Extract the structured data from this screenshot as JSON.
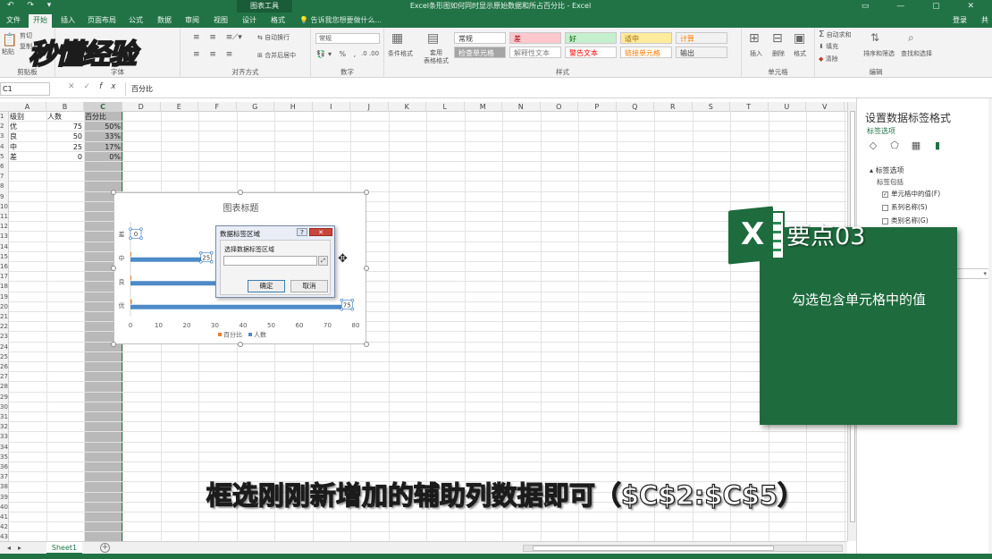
{
  "titlebar": {
    "quick_access": "↶ ↷ ▾",
    "context_tab": "图表工具",
    "document": "Excel条形图如何同时显示原始数据和所占百分比 - Excel",
    "window_controls": "▭ — ▢ ✕"
  },
  "tabs": [
    "文件",
    "开始",
    "插入",
    "页面布局",
    "公式",
    "数据",
    "审阅",
    "视图",
    "设计",
    "格式"
  ],
  "active_tab_index": 1,
  "tell_me": "告诉我您想要做什么...",
  "login": "登录",
  "share": "共享",
  "ribbon": {
    "clipboard": {
      "label": "剪贴板",
      "cut": "剪切",
      "copy": "复制",
      "paste": "粘贴"
    },
    "font": {
      "label": "字体"
    },
    "alignment": {
      "label": "对齐方式",
      "wrap": "自动换行",
      "merge": "合并后居中"
    },
    "number": {
      "label": "数字",
      "format": "常规"
    },
    "styles": {
      "label": "样式",
      "conditional": "条件格式",
      "table": "套用\n表格格式",
      "cells": [
        {
          "text": "常规",
          "bg": "#ffffff",
          "fg": "#333333"
        },
        {
          "text": "差",
          "bg": "#ffc7ce",
          "fg": "#9c0006"
        },
        {
          "text": "好",
          "bg": "#c6efce",
          "fg": "#006100"
        },
        {
          "text": "适中",
          "bg": "#ffeb9c",
          "fg": "#9c6500"
        },
        {
          "text": "计算",
          "bg": "#f2f2f2",
          "fg": "#fa7d00"
        },
        {
          "text": "检查单元格",
          "bg": "#a5a5a5",
          "fg": "#ffffff"
        },
        {
          "text": "解释性文本",
          "bg": "#ffffff",
          "fg": "#7f7f7f"
        },
        {
          "text": "警告文本",
          "bg": "#ffffff",
          "fg": "#ff0000"
        },
        {
          "text": "链接单元格",
          "bg": "#ffffff",
          "fg": "#fa7d00"
        },
        {
          "text": "输出",
          "bg": "#f2f2f2",
          "fg": "#3f3f3f"
        }
      ]
    },
    "cells": {
      "label": "单元格",
      "insert": "插入",
      "delete": "删除",
      "format": "格式"
    },
    "editing": {
      "label": "编辑",
      "autosum": "自动求和",
      "fill": "填充",
      "clear": "清除",
      "sort": "排序和筛选",
      "find": "查找和选择"
    }
  },
  "watermark": "秒懂经验",
  "formula_bar": {
    "name_box": "C1",
    "cancel": "✕",
    "enter": "✓",
    "fx": "fx",
    "formula": "百分比"
  },
  "columns": [
    "A",
    "B",
    "C",
    "D",
    "E",
    "F",
    "G",
    "H",
    "I",
    "J",
    "K",
    "L",
    "M",
    "N",
    "O",
    "P",
    "Q",
    "R",
    "S",
    "T",
    "U",
    "V"
  ],
  "rows": [
    "1",
    "2",
    "3",
    "4",
    "5",
    "6",
    "7",
    "8",
    "9",
    "10",
    "11",
    "12",
    "13",
    "14",
    "15",
    "16",
    "17",
    "18",
    "19",
    "20",
    "21",
    "22",
    "23",
    "24",
    "25",
    "26",
    "27",
    "28",
    "29",
    "30",
    "31",
    "32",
    "33",
    "34",
    "35",
    "36",
    "37",
    "38",
    "39",
    "40",
    "41",
    "42",
    "43"
  ],
  "table": {
    "headers": [
      "级别",
      "人数",
      "百分比"
    ],
    "rows": [
      [
        "优",
        "75",
        "50%"
      ],
      [
        "良",
        "50",
        "33%"
      ],
      [
        "中",
        "25",
        "17%"
      ],
      [
        "差",
        "0",
        "0%"
      ]
    ]
  },
  "chart_data": {
    "type": "bar",
    "title": "图表标题",
    "categories": [
      "差",
      "中",
      "良",
      "优"
    ],
    "series": [
      {
        "name": "百分比",
        "values": [
          0,
          0.17,
          0.33,
          0.5
        ],
        "color": "#ed7d31"
      },
      {
        "name": "人数",
        "values": [
          0,
          25,
          50,
          75
        ],
        "color": "#4e8ac8"
      }
    ],
    "xlim": [
      0,
      80
    ],
    "xticks": [
      "0",
      "10",
      "20",
      "30",
      "40",
      "50",
      "60",
      "70",
      "80"
    ],
    "data_labels": {
      "差": "0",
      "中": "25",
      "优": "75"
    },
    "legend": "bottom",
    "grid": false
  },
  "dialog": {
    "title": "数据标签区域",
    "help": "?",
    "close": "✕",
    "prompt": "选择数据标签区域",
    "value": "",
    "ok": "确定",
    "cancel": "取消"
  },
  "sheet": {
    "name": "Sheet1",
    "add": "+"
  },
  "pane": {
    "title": "设置数据标签格式",
    "subtitle": "标签选项",
    "section": "标签选项",
    "contains": "标签包括",
    "options": [
      {
        "label": "单元格中的值(F)",
        "checked": true
      },
      {
        "label": "系列名称(S)",
        "checked": false
      },
      {
        "label": "类别名称(G)",
        "checked": false
      }
    ]
  },
  "overlay": {
    "logo_letter": "X",
    "point_label": "要点03",
    "card_text": "勾选包含单元格中的值"
  },
  "caption": "框选刚刚新增加的辅助列数据即可（$C$2:$C$5）"
}
